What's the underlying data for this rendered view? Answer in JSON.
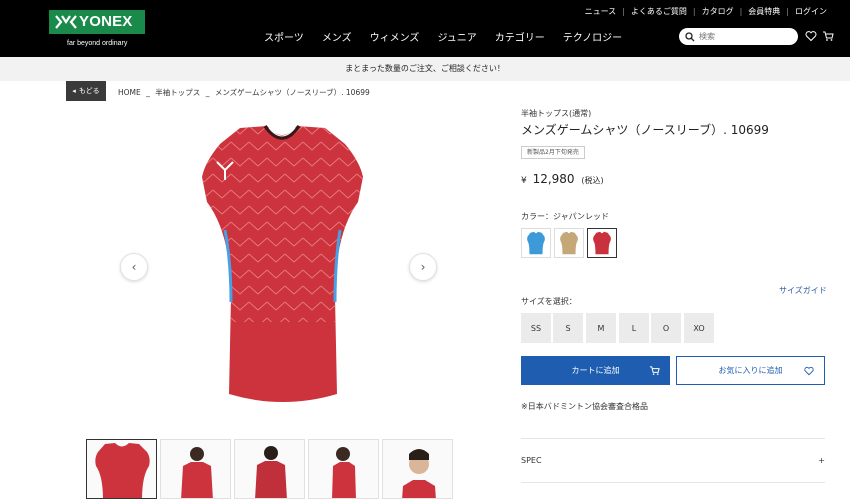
{
  "header": {
    "logo_text": "YONEX",
    "logo_tagline": "far beyond ordinary",
    "utility_nav": [
      "ニュース",
      "よくあるご質問",
      "カタログ",
      "会員特典",
      "ログイン"
    ],
    "main_nav": [
      "スポーツ",
      "メンズ",
      "ウィメンズ",
      "ジュニア",
      "カテゴリー",
      "テクノロジー"
    ],
    "search_placeholder": "検索"
  },
  "banner": "まとまった数量のご注文、ご相談ください！",
  "breadcrumb": {
    "back_label": "もどる",
    "items": [
      "HOME",
      "_",
      "半袖トップス",
      "_",
      "メンズゲームシャツ（ノースリーブ）. 10699"
    ]
  },
  "product": {
    "category": "半袖トップス(通常)",
    "title": "メンズゲームシャツ（ノースリーブ）. 10699",
    "badge": "新製品2月下旬発売",
    "price_yen": "¥",
    "price_value": "12,980",
    "price_tax": "(税込)",
    "color_label": "カラー：ジャパンレッド",
    "colors": [
      {
        "name": "blue",
        "hex": "#3d9ad9"
      },
      {
        "name": "beige",
        "hex": "#c4a878"
      },
      {
        "name": "japan-red",
        "hex": "#c9323c"
      }
    ],
    "size_guide": "サイズガイド",
    "size_label": "サイズを選択：",
    "sizes": [
      "SS",
      "S",
      "M",
      "L",
      "O",
      "XO"
    ],
    "cart_button": "カートに追加",
    "favorite_button": "お気に入りに追加",
    "approval_note": "※日本バドミントン協会審査合格品",
    "spec_label": "SPEC",
    "spec_toggle": "+"
  },
  "colors": {
    "header_bg": "#000000",
    "logo_green": "#1a8a4a",
    "primary_blue": "#1e5db0",
    "shirt_red": "#c9323c"
  }
}
